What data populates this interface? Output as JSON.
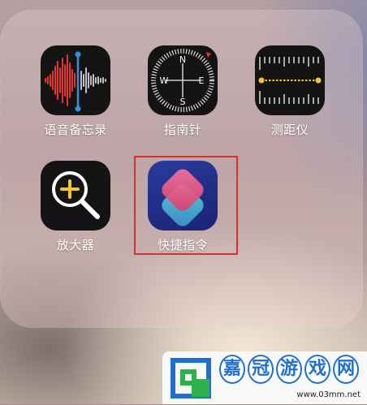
{
  "folder": {
    "apps": [
      {
        "id": "voice-memos",
        "label": "语音备忘录",
        "icon": "voice-memos-icon"
      },
      {
        "id": "compass",
        "label": "指南针",
        "icon": "compass-icon",
        "compass_letters": [
          "N",
          "E",
          "S",
          "W"
        ]
      },
      {
        "id": "measure",
        "label": "测距仪",
        "icon": "measure-icon"
      },
      {
        "id": "magnifier",
        "label": "放大器",
        "icon": "magnifier-icon"
      },
      {
        "id": "shortcuts",
        "label": "快捷指令",
        "icon": "shortcuts-icon",
        "highlighted": true
      }
    ]
  },
  "colors": {
    "highlight_box": "#d8322a",
    "voice_memos_wave": "#e8322f",
    "voice_memos_marker": "#3a8dde",
    "magnifier_plus": "#f7c62f",
    "measure_line": "#f7c62f",
    "watermark_blue": "#1e6fd0"
  },
  "watermark": {
    "characters": [
      "嘉",
      "冠",
      "游",
      "戏",
      "网"
    ],
    "url": "www.03mm.net"
  }
}
